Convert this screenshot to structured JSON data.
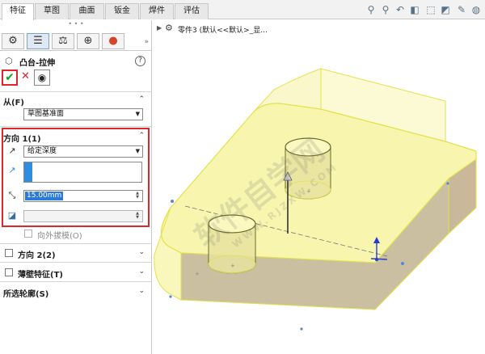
{
  "tabs": [
    "特征",
    "草图",
    "曲面",
    "钣金",
    "焊件",
    "评估"
  ],
  "active_tab": "特征",
  "view_toolbar_icons": [
    "zoom-to-fit-icon",
    "zoom-area-icon",
    "previous-view-icon",
    "section-view-icon",
    "view-orientation-icon",
    "display-style-icon",
    "hide-show-icon",
    "appearance-icon"
  ],
  "feature": {
    "title": "凸台-拉伸",
    "help": "?",
    "ok": "✔",
    "cancel": "✕"
  },
  "from_section": {
    "title": "从(F)",
    "value": "草图基准面"
  },
  "direction1": {
    "title": "方向 1(1)",
    "end_condition": "给定深度",
    "depth": "15.00mm",
    "draft_label": "向外拔模(O)"
  },
  "direction2": {
    "title": "方向 2(2)"
  },
  "thin_feature": {
    "title": "薄壁特征(T)"
  },
  "selected_contours": {
    "title": "所选轮廓(S)"
  },
  "breadcrumb": "零件3 (默认<<默认>_显...",
  "watermark": {
    "cn": "软件自学网",
    "url": "WWW.RJZXW.COM"
  },
  "colors": {
    "accent_red": "#e0262c",
    "ok_green": "#17a31f",
    "selection_blue": "#2e8de0",
    "model_yellow": "#f6f3a0",
    "model_edge": "#e2e24a"
  }
}
